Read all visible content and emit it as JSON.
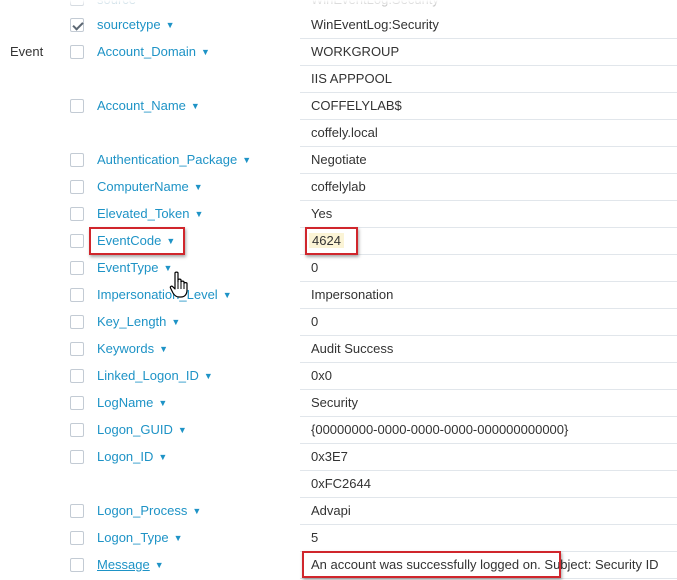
{
  "sections": {
    "event": "Event"
  },
  "partial_row": {
    "field": "source",
    "value": "WinEventLog:Security"
  },
  "rows": [
    {
      "field": "sourcetype",
      "values": [
        "WinEventLog:Security"
      ],
      "checked": true
    },
    {
      "field": "Account_Domain",
      "values": [
        "WORKGROUP",
        "IIS APPPOOL"
      ],
      "checked": false
    },
    {
      "field": "Account_Name",
      "values": [
        "COFFELYLAB$",
        "coffely.local"
      ],
      "checked": false
    },
    {
      "field": "Authentication_Package",
      "values": [
        "Negotiate"
      ],
      "checked": false
    },
    {
      "field": "ComputerName",
      "values": [
        "coffelylab"
      ],
      "checked": false
    },
    {
      "field": "Elevated_Token",
      "values": [
        "Yes"
      ],
      "checked": false
    },
    {
      "field": "EventCode",
      "values": [
        "4624"
      ],
      "checked": false,
      "highlighted": true
    },
    {
      "field": "EventType",
      "values": [
        "0"
      ],
      "checked": false
    },
    {
      "field": "Impersonation_Level",
      "values": [
        "Impersonation"
      ],
      "checked": false
    },
    {
      "field": "Key_Length",
      "values": [
        "0"
      ],
      "checked": false
    },
    {
      "field": "Keywords",
      "values": [
        "Audit Success"
      ],
      "checked": false
    },
    {
      "field": "Linked_Logon_ID",
      "values": [
        "0x0"
      ],
      "checked": false
    },
    {
      "field": "LogName",
      "values": [
        "Security"
      ],
      "checked": false
    },
    {
      "field": "Logon_GUID",
      "values": [
        "{00000000-0000-0000-0000-000000000000}"
      ],
      "checked": false
    },
    {
      "field": "Logon_ID",
      "values": [
        "0x3E7",
        "0xFC2644"
      ],
      "checked": false
    },
    {
      "field": "Logon_Process",
      "values": [
        "Advapi"
      ],
      "checked": false
    },
    {
      "field": "Logon_Type",
      "values": [
        "5"
      ],
      "checked": false
    },
    {
      "field": "Message",
      "values": [
        "An account was successfully logged on. Subject: Security ID"
      ],
      "checked": false,
      "underlined": true
    }
  ],
  "colors": {
    "field_link": "#1e93c6",
    "annotation_box": "#d0262c",
    "highlight": "#fbf4d6"
  },
  "icons": {
    "caret": "caret-down-icon",
    "cursor": "hand-pointer-icon"
  }
}
